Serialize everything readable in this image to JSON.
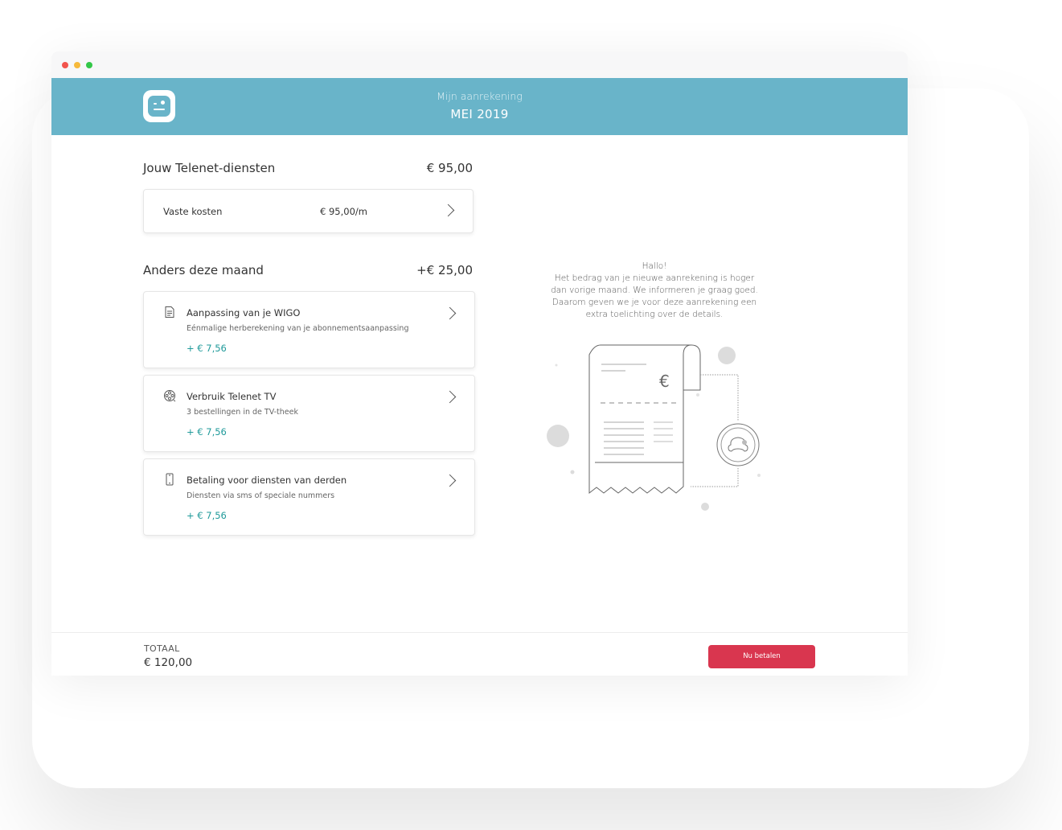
{
  "header": {
    "subtitle": "Mijn aanrekening",
    "title": "MEI 2019",
    "logo_icon": "telenet-smiley-logo",
    "color": "#69b4c9"
  },
  "services": {
    "title": "Jouw Telenet-diensten",
    "amount": "€ 95,00",
    "fixed": {
      "label": "Vaste kosten",
      "price": "€ 95,00/m"
    }
  },
  "changes": {
    "title": "Anders deze maand",
    "amount": "+€ 25,00",
    "accent": "#1f9a9a",
    "items": [
      {
        "title": "Aanpassing van je WIGO",
        "desc": "Eénmalige herberekening van je abonnementsaanpassing",
        "amount": "+ € 7,56",
        "icon": "document-icon"
      },
      {
        "title": "Verbruik Telenet TV",
        "desc": "3 bestellingen in de TV-theek",
        "amount": "+ € 7,56",
        "icon": "film-reel-icon"
      },
      {
        "title": "Betaling voor diensten van derden",
        "desc": "Diensten via sms of speciale nummers",
        "amount": "+ € 7,56",
        "icon": "mobile-phone-icon"
      }
    ]
  },
  "message": {
    "greeting": "Hallo!",
    "lines": [
      "Het bedrag van je nieuwe aanrekening is hoger",
      "dan vorige maand. We informeren je graag goed.",
      "Daarom geven we je voor deze aanrekening een",
      "extra toelichting over de details."
    ],
    "illustration_symbol": "€"
  },
  "footer": {
    "total_label": "TOTAAL",
    "total_value": "€ 120,00",
    "pay_button": "Nu betalen",
    "pay_color": "#d9364f"
  }
}
